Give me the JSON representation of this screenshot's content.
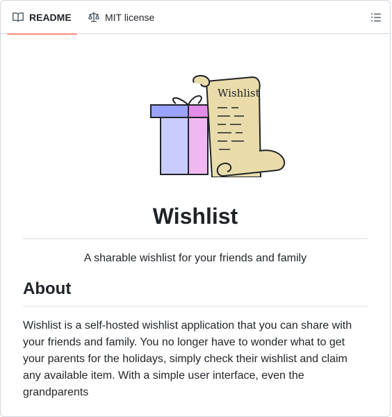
{
  "tabs": {
    "readme_label": "README",
    "license_label": "MIT license",
    "active_underline_color": "#fd8c73"
  },
  "icons": {
    "readme": "book-icon",
    "license": "law-scale-icon",
    "toc": "list-unordered-icon"
  },
  "logo": {
    "scroll_text": "Wishlist"
  },
  "main": {
    "title": "Wishlist",
    "tagline": "A sharable wishlist for your friends and family",
    "about_heading": "About",
    "about_text": "Wishlist is a self-hosted wishlist application that you can share with your friends and family. You no longer have to wonder what to get your parents for the holidays, simply check their wishlist and claim any available item. With a simple user interface, even the grandparents"
  }
}
